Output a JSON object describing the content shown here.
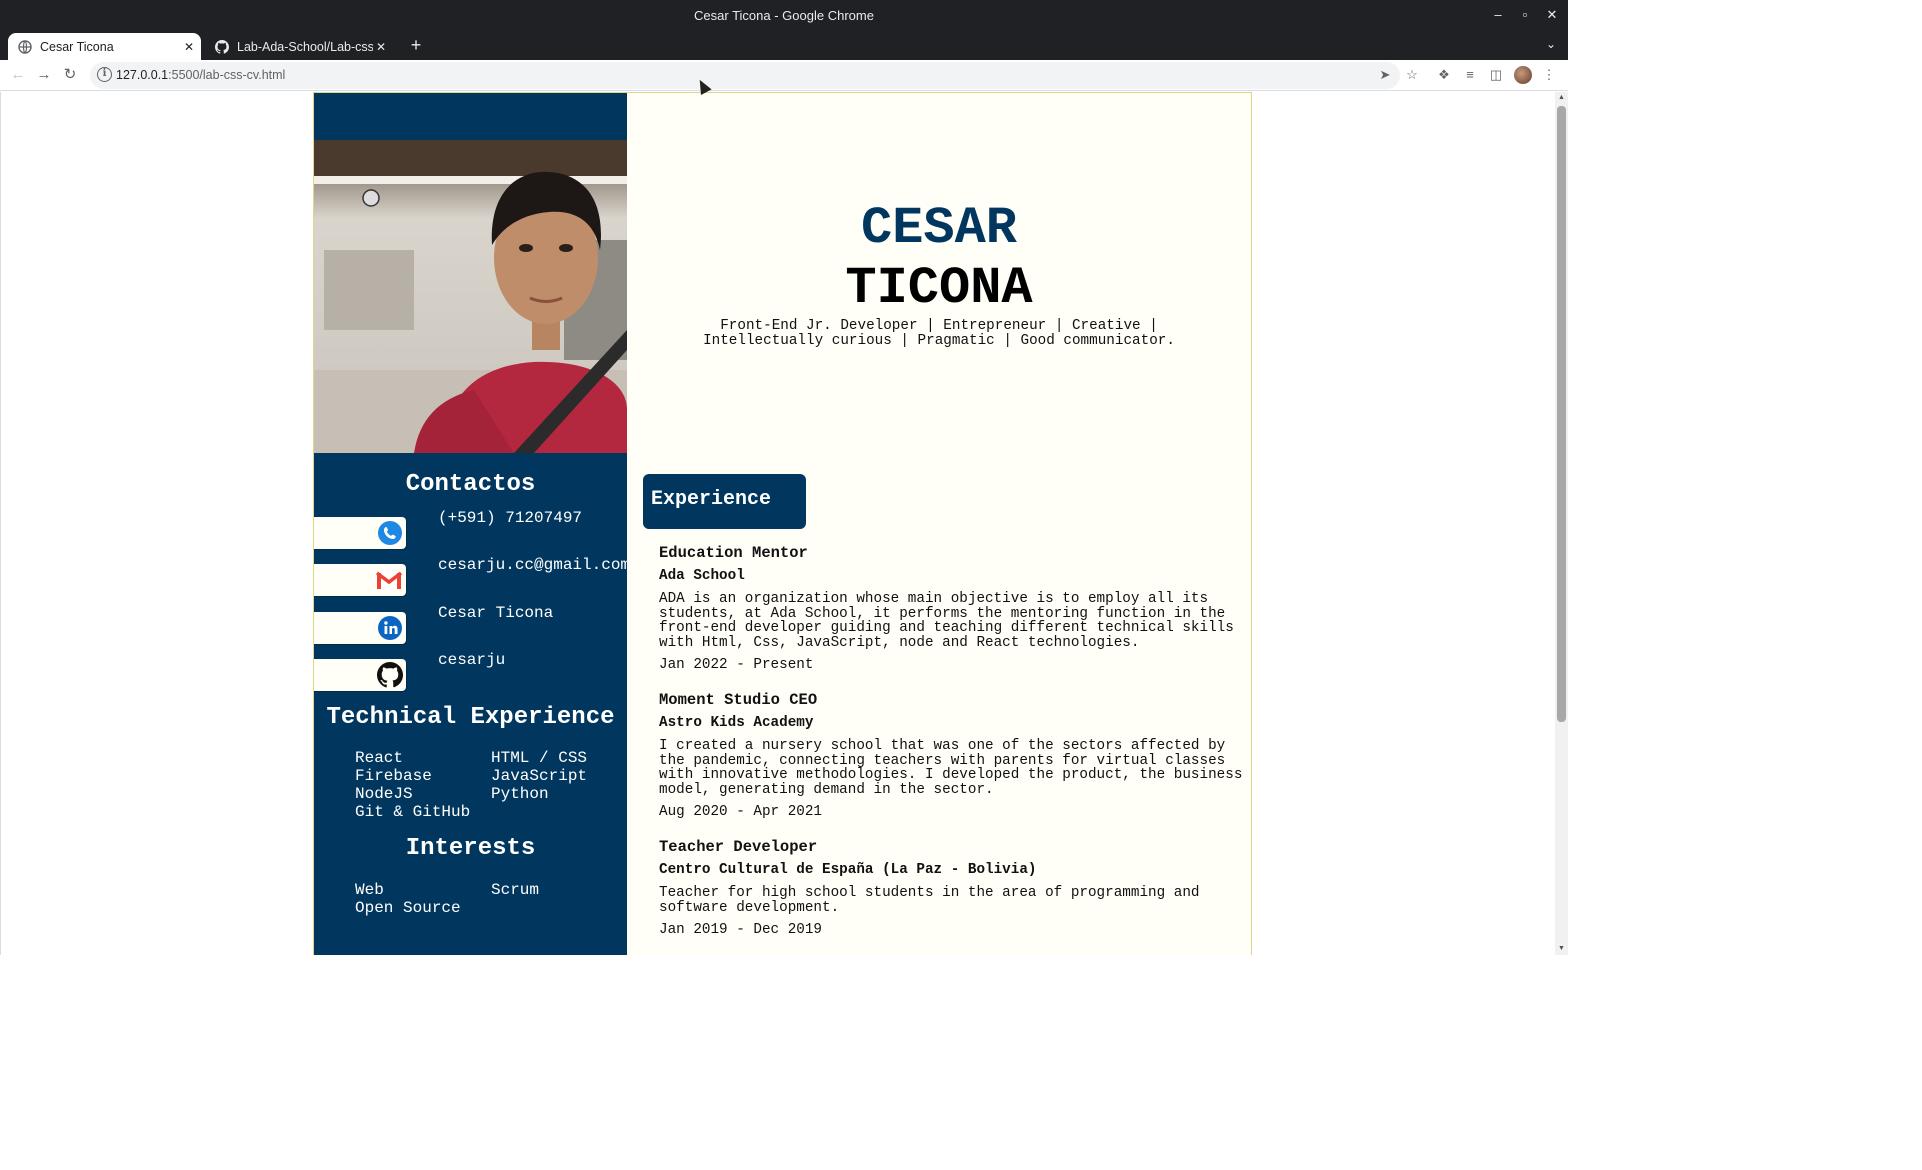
{
  "window": {
    "title": "Cesar Ticona - Google Chrome"
  },
  "tabs": [
    {
      "label": "Cesar Ticona",
      "active": true
    },
    {
      "label": "Lab-Ada-School/Lab-css-",
      "active": false
    }
  ],
  "address_bar": {
    "host": "127.0.0.1",
    "rest": ":5500/lab-css-cv.html"
  },
  "cv": {
    "first_name": "CESAR",
    "last_name": "TICONA",
    "tagline": "Front-End Jr. Developer | Entrepreneur | Creative | Intellectually curious | Pragmatic | Good communicator.",
    "contacts_title": "Contactos",
    "contacts": [
      {
        "icon": "phone-icon",
        "text": "(+591) 71207497"
      },
      {
        "icon": "gmail-icon",
        "text": "cesarju.cc@gmail.com"
      },
      {
        "icon": "linkedin-icon",
        "text": "Cesar Ticona"
      },
      {
        "icon": "github-icon",
        "text": "cesarju"
      }
    ],
    "tech_title": "Technical Experience",
    "tech": [
      "React",
      "HTML / CSS",
      "Firebase",
      "JavaScript",
      "NodeJS",
      "Python",
      "Git & GitHub"
    ],
    "interests_title": "Interests",
    "interests": [
      "Web",
      "Scrum",
      "Open Source"
    ],
    "experience_title": "Experience",
    "jobs": [
      {
        "role": "Education Mentor",
        "org": "Ada School",
        "desc": "ADA is an organization whose main objective is to employ all its students, at Ada School, it performs the mentoring function in the front-end developer guiding and teaching different technical skills with Html, Css, JavaScript, node and React technologies.",
        "date": "Jan 2022 - Present"
      },
      {
        "role": "Moment Studio CEO",
        "org": "Astro Kids Academy",
        "desc": "I created a nursery school that was one of the sectors affected by the pandemic, connecting teachers with parents for virtual classes with innovative methodologies. I developed the product, the business model, generating demand in the sector.",
        "date": "Aug 2020 - Apr 2021"
      },
      {
        "role": "Teacher Developer",
        "org": "Centro Cultural de España (La Paz - Bolivia)",
        "desc": "Teacher for high school students in the area of programming and software development.",
        "date": "Jan 2019 - Dec 2019"
      }
    ]
  }
}
